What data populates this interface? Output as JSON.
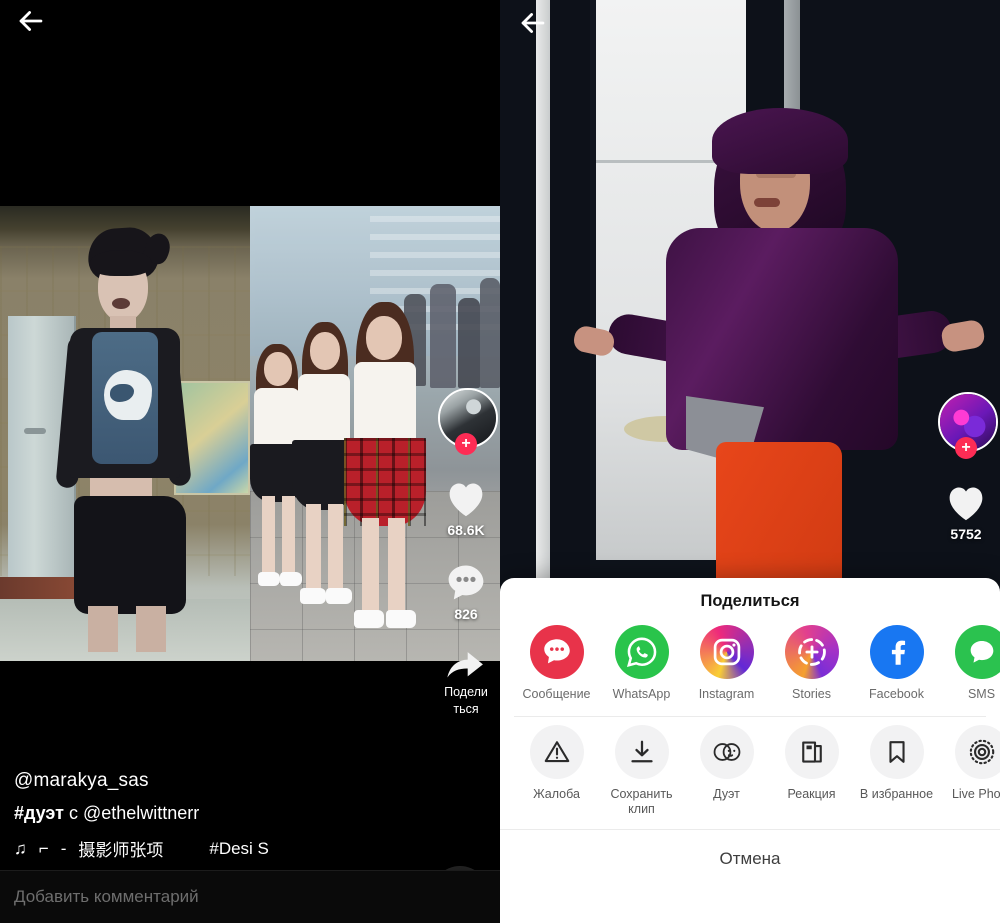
{
  "left_panel": {
    "back_icon": "back-arrow-icon",
    "video": {
      "type": "duet-split",
      "left_clip_description": "person dancing in room",
      "right_clip_description": "group of girls dancing on street"
    },
    "rail": {
      "avatar": "creator-avatar",
      "follow_label": "+",
      "like_icon": "heart-icon",
      "like_count": "68.6K",
      "comment_icon": "comment-bubble-icon",
      "comment_count": "826",
      "share_icon": "share-arrow-icon",
      "share_label_line1": "Подели",
      "share_label_line2": "ться"
    },
    "caption": {
      "username": "@marakya_sas",
      "hashtag": "#дуэт",
      "with_word": "с",
      "partner": "@ethelwittnerr",
      "music_note": "♫",
      "music_prefix": "⌐",
      "music_dash": "-",
      "music_title": "摄影师张项",
      "music_hashtag": "#Desi S"
    },
    "music_disc": "rotating-record-icon",
    "note_glyph_a": "♪",
    "note_glyph_b": "♫",
    "comment_input_placeholder": "Добавить комментарий"
  },
  "right_panel": {
    "back_icon": "back-arrow-icon",
    "video": {
      "type": "single-clip",
      "description": "person in purple hoodie and orange pants in hallway"
    },
    "rail": {
      "avatar": "creator-avatar",
      "follow_label": "+",
      "like_icon": "heart-icon",
      "like_count": "5752"
    },
    "share_sheet": {
      "title": "Поделиться",
      "apps": [
        {
          "name": "Сообщение",
          "icon": "message-bubble-icon",
          "color": "#e8334a"
        },
        {
          "name": "WhatsApp",
          "icon": "whatsapp-icon",
          "color": "#29c44b"
        },
        {
          "name": "Instagram",
          "icon": "instagram-icon",
          "color": "#ee2a7b"
        },
        {
          "name": "Stories",
          "icon": "instagram-stories-icon",
          "color": "#a431c6"
        },
        {
          "name": "Facebook",
          "icon": "facebook-icon",
          "color": "#1877f2"
        },
        {
          "name": "SMS",
          "icon": "sms-bubble-icon",
          "color": "#2bc24f"
        }
      ],
      "actions": [
        {
          "name": "Жалоба",
          "icon": "warning-triangle-icon"
        },
        {
          "name": "Сохранить клип",
          "icon": "download-icon"
        },
        {
          "name": "Дуэт",
          "icon": "duet-circles-icon"
        },
        {
          "name": "Реакция",
          "icon": "reaction-icon"
        },
        {
          "name": "В избранное",
          "icon": "bookmark-icon"
        },
        {
          "name": "Live Photo",
          "icon": "live-photo-icon"
        }
      ],
      "cancel_label": "Отмена"
    }
  }
}
